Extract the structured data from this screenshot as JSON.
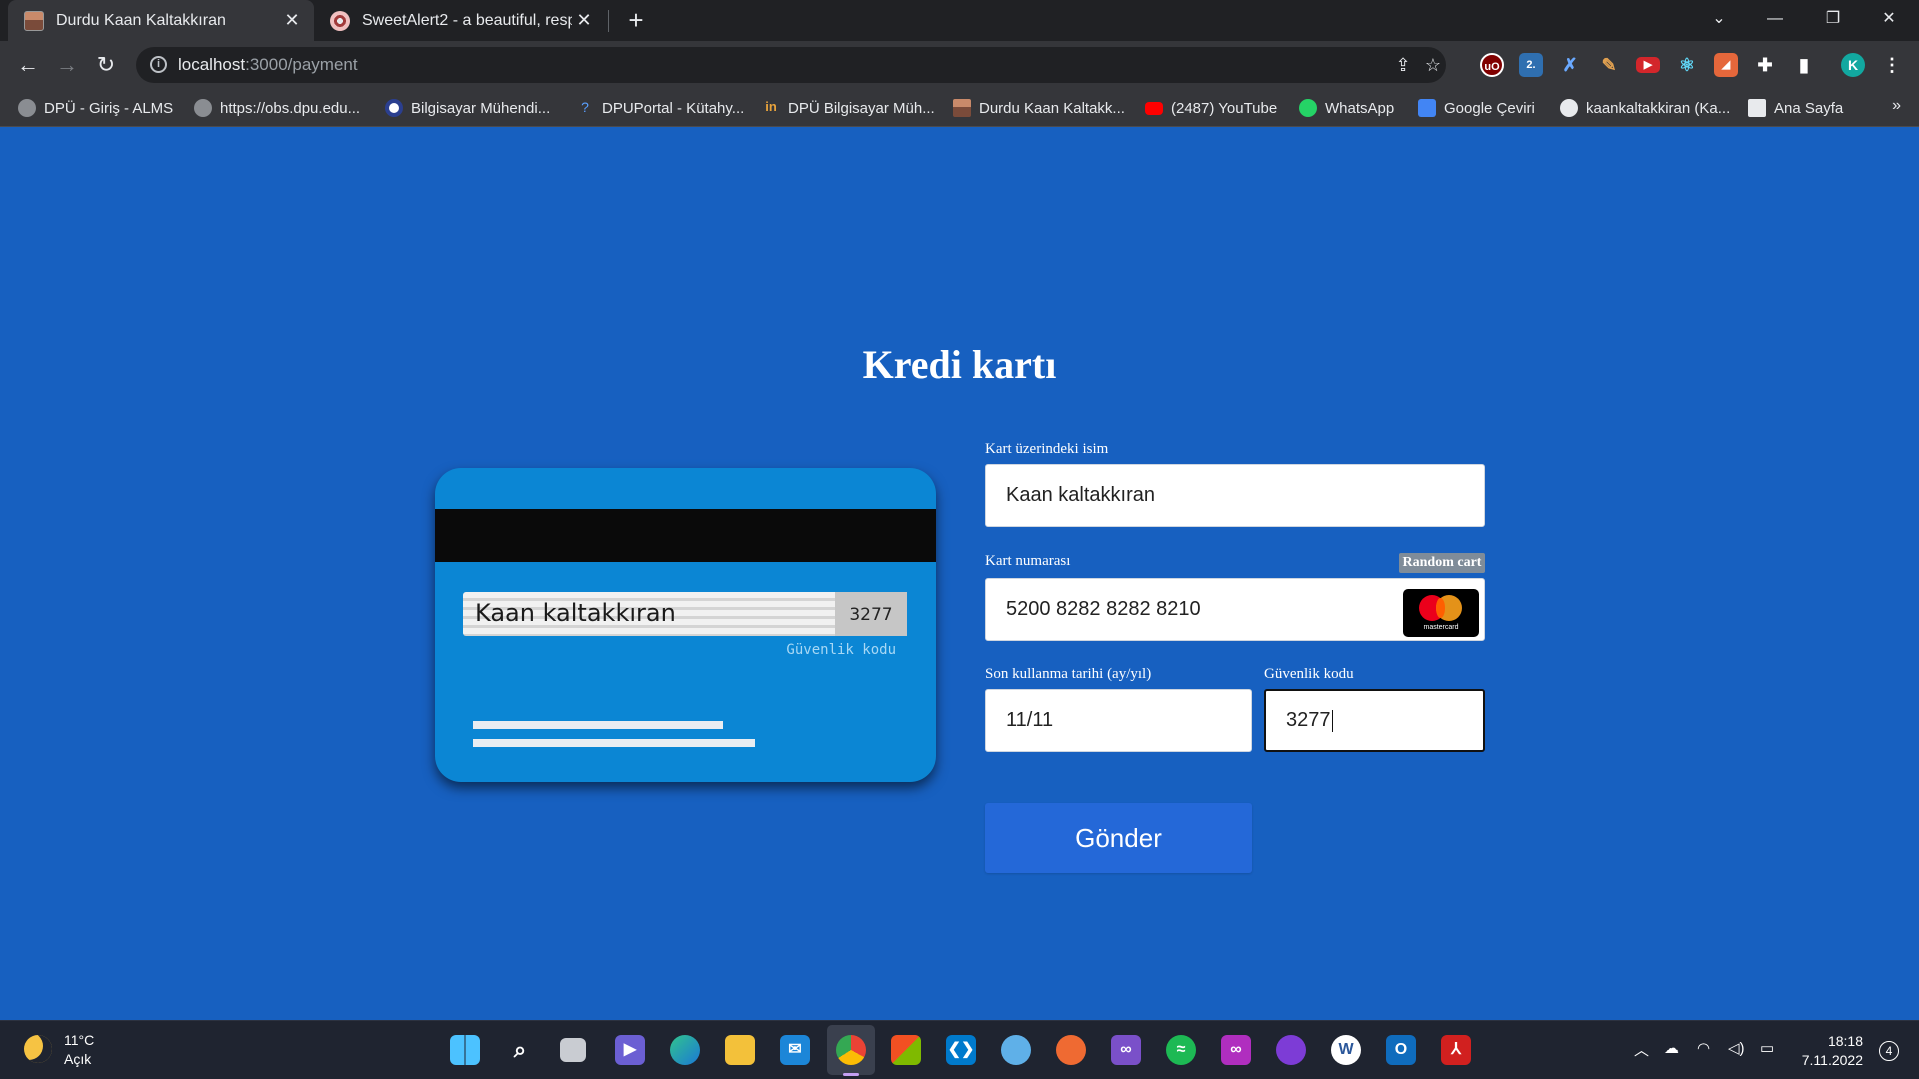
{
  "browser": {
    "tabs": [
      {
        "title": "Durdu Kaan Kaltakkıran",
        "active": true,
        "favicon": "person-photo-icon"
      },
      {
        "title": "SweetAlert2 - a beautiful, respon",
        "active": false,
        "favicon": "sweetalert-icon"
      }
    ],
    "close_glyph": "✕",
    "new_tab_glyph": "+",
    "url_host": "localhost",
    "url_path": ":3000/payment",
    "profile_initial": "K",
    "bookmarks": [
      {
        "label": "DPÜ - Giriş - ALMS",
        "icon": "globe-icon"
      },
      {
        "label": "https://obs.dpu.edu...",
        "icon": "globe-icon"
      },
      {
        "label": "Bilgisayar Mühendi...",
        "icon": "dpu-icon"
      },
      {
        "label": "DPUPortal - Kütahy...",
        "icon": "question-icon"
      },
      {
        "label": "DPÜ Bilgisayar Müh...",
        "icon": "linkedin-icon"
      },
      {
        "label": "Durdu Kaan Kaltakk...",
        "icon": "person-photo-icon"
      },
      {
        "label": "(2487) YouTube",
        "icon": "youtube-icon"
      },
      {
        "label": "WhatsApp",
        "icon": "whatsapp-icon"
      },
      {
        "label": "Google Çeviri",
        "icon": "google-translate-icon"
      },
      {
        "label": "kaankaltakkiran (Ka...",
        "icon": "github-icon"
      },
      {
        "label": "Ana Sayfa",
        "icon": "btk-icon"
      }
    ],
    "bookmarks_more": "»"
  },
  "page": {
    "heading": "Kredi kartı",
    "card_preview": {
      "name": "Kaan kaltakkıran",
      "cvv": "3277",
      "cvv_caption": "Güvenlik kodu"
    },
    "form": {
      "name_label": "Kart üzerindeki isim",
      "name_value": "Kaan kaltakkıran",
      "number_label": "Kart numarası",
      "random_button": "Random cart",
      "number_value": "5200 8282 8282 8210",
      "card_brand": "mastercard",
      "expiry_label": "Son kullanma tarihi (ay/yıl)",
      "expiry_value": "11/11",
      "cvv_label": "Güvenlik kodu",
      "cvv_value": "3277",
      "submit_label": "Gönder"
    }
  },
  "taskbar": {
    "temperature": "11°C",
    "condition": "Açık",
    "time": "18:18",
    "date": "7.11.2022",
    "notifications": "4",
    "apps": [
      "windows-start-icon",
      "search-icon",
      "task-view-icon",
      "teams-icon",
      "edge-icon",
      "file-explorer-icon",
      "mail-icon",
      "chrome-icon",
      "store-icon",
      "vscode-icon",
      "paint-icon",
      "postman-icon",
      "visual-studio-icon",
      "spotify-icon",
      "arduino-icon",
      "github-desktop-icon",
      "word-icon",
      "outlook-icon",
      "acrobat-icon"
    ]
  },
  "colors": {
    "page_background": "#1760c0",
    "card_background": "#0b86d4",
    "submit_button": "#2468d8",
    "random_button": "#7f8c99"
  }
}
